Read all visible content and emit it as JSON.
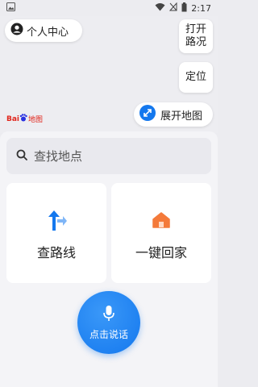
{
  "status_bar": {
    "time": "2:17"
  },
  "map": {
    "personal_center_label": "个人中心",
    "traffic_label": "打开\n路况",
    "locate_label": "定位",
    "expand_map_label": "展开地图",
    "logo": {
      "bai": "Bai",
      "du": "du",
      "map": "地图"
    }
  },
  "search": {
    "placeholder": "查找地点"
  },
  "cards": {
    "route_label": "查路线",
    "home_label": "一键回家"
  },
  "voice": {
    "label": "点击说话"
  },
  "colors": {
    "accent": "#1478ee",
    "home_icon": "#f47a3a",
    "logo_red": "#e1251b"
  }
}
